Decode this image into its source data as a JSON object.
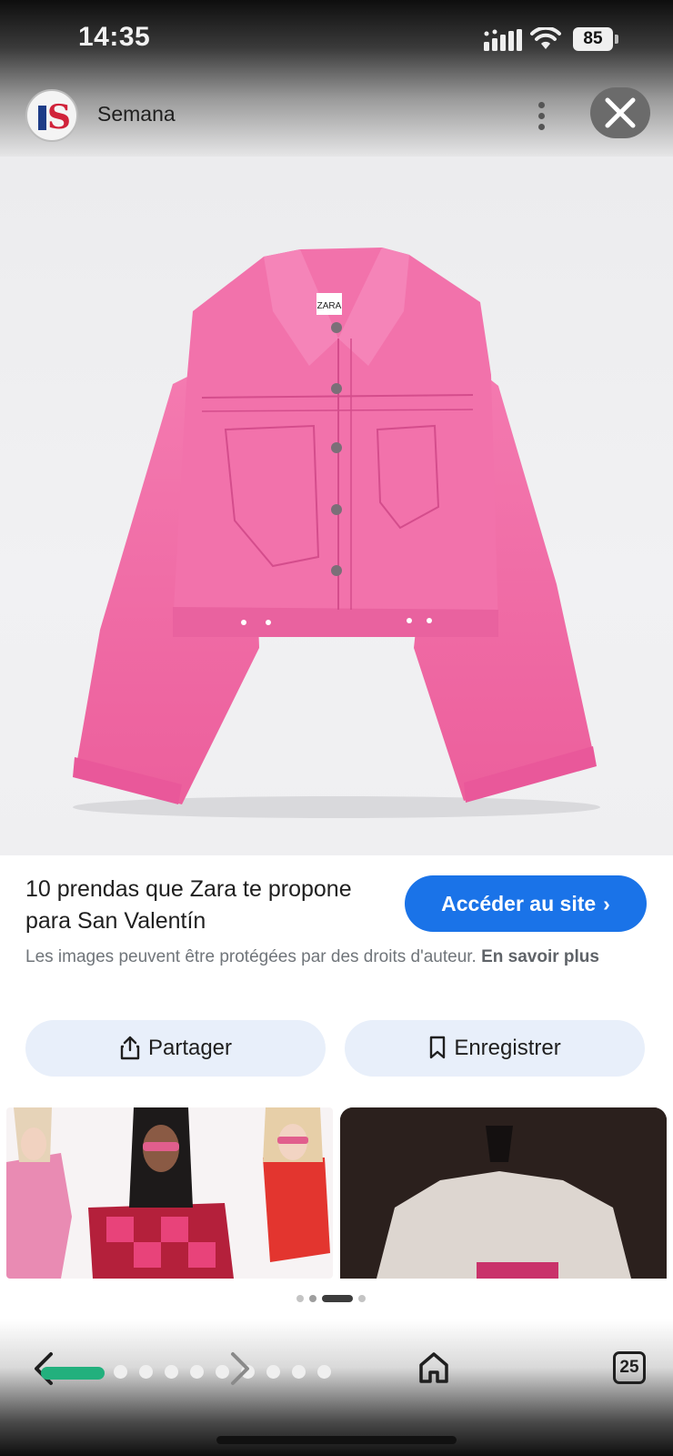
{
  "status_bar": {
    "time": "14:35",
    "battery": "85"
  },
  "header": {
    "source_name": "Semana",
    "source_logo_letter": "S",
    "more_icon": "more-vert-icon",
    "close_icon": "close-icon"
  },
  "main_image": {
    "subject": "pink denim jacket",
    "label_text": "ZARA"
  },
  "info": {
    "title": "10 prendas que Zara te propone para San Valentín",
    "visit_label": "Accéder au site",
    "visit_chevron": "›",
    "copyright_text": "Les images peuvent être protégées par des droits d'auteur.",
    "learn_more_label": "En savoir plus"
  },
  "actions": {
    "share_label": "Partager",
    "save_label": "Enregistrer"
  },
  "related": {
    "count": 2
  },
  "pager": {
    "active_index": 2,
    "count": 4
  },
  "bottom_nav": {
    "tabs_count": "25"
  },
  "colors": {
    "accent": "#1a73e8",
    "progress": "#22b07d",
    "chip_bg": "#e8effa",
    "jacket": "#f06fa7"
  }
}
